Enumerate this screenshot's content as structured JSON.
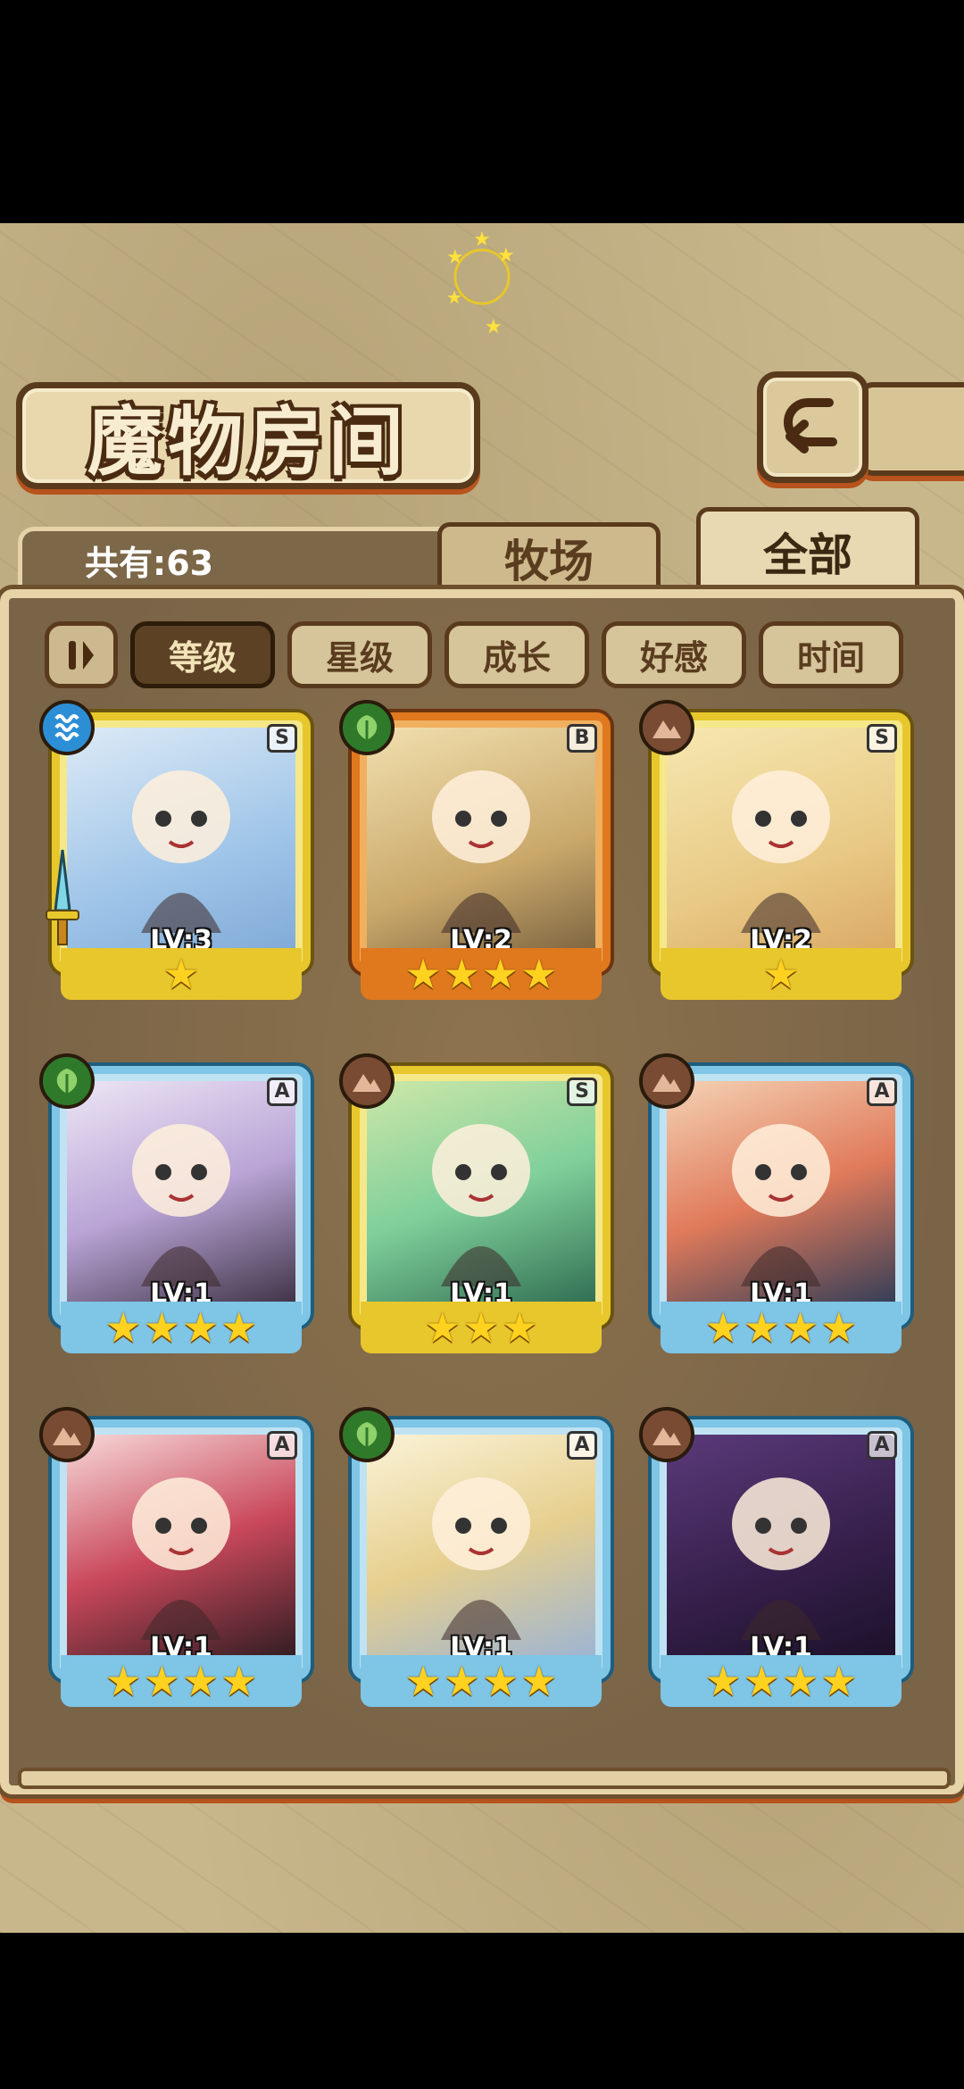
{
  "screen": {
    "title": "魔物房间"
  },
  "header": {
    "count_label": "共有:63"
  },
  "tabs": [
    {
      "label": "牧场",
      "active": false
    },
    {
      "label": "全部",
      "active": true
    }
  ],
  "sort_buttons": [
    {
      "label": "等级",
      "active": true
    },
    {
      "label": "星级",
      "active": false
    },
    {
      "label": "成长",
      "active": false
    },
    {
      "label": "好感",
      "active": false
    },
    {
      "label": "时间",
      "active": false
    }
  ],
  "monsters": [
    {
      "level": "LV:3",
      "rank": "S",
      "element": "water",
      "stars": 1,
      "portrait": "p1",
      "equipped": true
    },
    {
      "level": "LV:2",
      "rank": "B",
      "element": "leaf",
      "stars": 4,
      "portrait": "p2",
      "equipped": false
    },
    {
      "level": "LV:2",
      "rank": "S",
      "element": "earth",
      "stars": 1,
      "portrait": "p3",
      "equipped": false
    },
    {
      "level": "LV:1",
      "rank": "A",
      "element": "leaf",
      "stars": 4,
      "portrait": "p4",
      "equipped": false
    },
    {
      "level": "LV:1",
      "rank": "S",
      "element": "earth",
      "stars": 3,
      "portrait": "p5",
      "equipped": false
    },
    {
      "level": "LV:1",
      "rank": "A",
      "element": "earth",
      "stars": 4,
      "portrait": "p6",
      "equipped": false
    },
    {
      "level": "LV:1",
      "rank": "A",
      "element": "earth",
      "stars": 4,
      "portrait": "p7",
      "equipped": false
    },
    {
      "level": "LV:1",
      "rank": "A",
      "element": "leaf",
      "stars": 4,
      "portrait": "p8",
      "equipped": false
    },
    {
      "level": "LV:1",
      "rank": "A",
      "element": "earth",
      "stars": 4,
      "portrait": "p9",
      "equipped": false
    }
  ],
  "colors": {
    "panel": "#7a6447",
    "frame_S": "#e8c72c",
    "frame_B": "#e0781e",
    "frame_A": "#7ec5e6",
    "star": "#ffd21f"
  }
}
